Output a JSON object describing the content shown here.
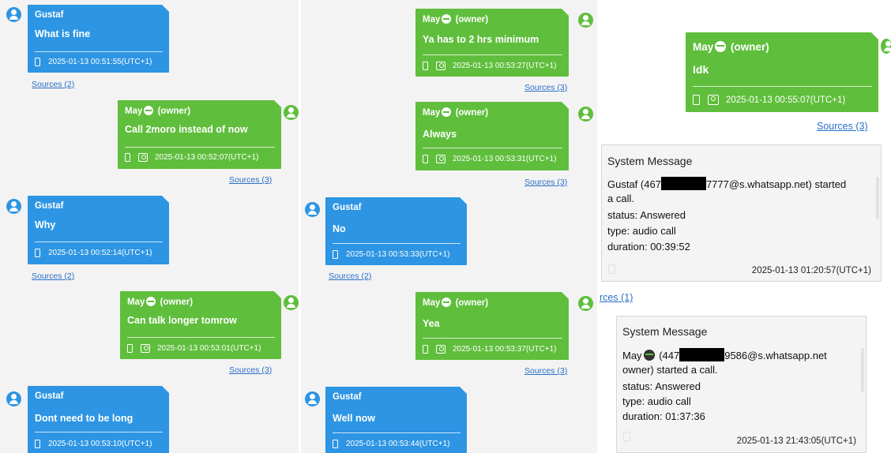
{
  "colors": {
    "incoming": "#2d95e3",
    "outgoing": "#5fbe3c",
    "link": "#2a6fc9"
  },
  "icons": {
    "contact": "user-avatar-icon",
    "device": "phone-icon",
    "group": "group-icon"
  },
  "col1": {
    "m1": {
      "sender": "Gustaf",
      "text": "What is fine",
      "time": "2025-01-13 00:51:55(UTC+1)",
      "sources": "Sources (2)"
    },
    "m2": {
      "sender": "May",
      "owner": "(owner)",
      "text": "Call 2moro instead of now",
      "time": "2025-01-13 00:52:07(UTC+1)",
      "sources": "Sources (3)"
    },
    "m3": {
      "sender": "Gustaf",
      "text": "Why",
      "time": "2025-01-13 00:52:14(UTC+1)",
      "sources": "Sources (2)"
    },
    "m4": {
      "sender": "May",
      "owner": "(owner)",
      "text": "Can talk longer tomrow",
      "time": "2025-01-13 00:53:01(UTC+1)",
      "sources": "Sources (3)"
    },
    "m5": {
      "sender": "Gustaf",
      "text": "Dont need to be long",
      "time": "2025-01-13 00:53:10(UTC+1)"
    }
  },
  "col2": {
    "m1": {
      "sender": "May",
      "owner": "(owner)",
      "text": "Ya has to 2 hrs minimum",
      "time": "2025-01-13 00:53:27(UTC+1)",
      "sources": "Sources (3)"
    },
    "m2": {
      "sender": "May",
      "owner": "(owner)",
      "text": "Always",
      "time": "2025-01-13 00:53:31(UTC+1)",
      "sources": "Sources (3)"
    },
    "m3": {
      "sender": "Gustaf",
      "text": "No",
      "time": "2025-01-13 00:53:33(UTC+1)",
      "sources": "Sources (2)"
    },
    "m4": {
      "sender": "May",
      "owner": "(owner)",
      "text": "Yea",
      "time": "2025-01-13 00:53:37(UTC+1)",
      "sources": "Sources (3)"
    },
    "m5": {
      "sender": "Gustaf",
      "text": "Well now",
      "time": "2025-01-13 00:53:44(UTC+1)"
    }
  },
  "col3": {
    "m1": {
      "sender": "May",
      "owner": "(owner)",
      "text": "Idk",
      "time": "2025-01-13 00:55:07(UTC+1)",
      "sources": "Sources (3)"
    },
    "sys1": {
      "title": "System Message",
      "l1a": "Gustaf (467",
      "l1b": "7777@s.whatsapp.net) started",
      "l2": "a call.",
      "l3": "status: Answered",
      "l4": "type: audio call",
      "l5": "duration: 00:39:52",
      "time": "2025-01-13 01:20:57(UTC+1)",
      "sources": "rces (1)"
    },
    "sys2": {
      "title": "System Message",
      "l1a": "May",
      "l1b": "(447",
      "l1c": "9586@s.whatsapp.net",
      "l2": "owner) started a call.",
      "l3": "status: Answered",
      "l4": "type: audio call",
      "l5": "duration: 01:37:36",
      "time": "2025-01-13 21:43:05(UTC+1)"
    }
  }
}
